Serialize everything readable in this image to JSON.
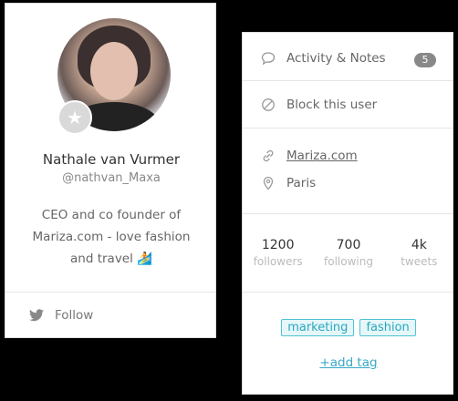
{
  "profile": {
    "name": "Nathale van Vurmer",
    "handle": "@nathvan_Maxa",
    "bio_line1": "CEO and co founder of",
    "bio_line2": "Mariza.com - love fashion",
    "bio_line3": "and travel",
    "bio_emoji": "🏄",
    "follow_label": "Follow"
  },
  "info": {
    "activity_label": "Activity & Notes",
    "activity_count": "5",
    "block_label": "Block this user",
    "website": "Mariza.com",
    "location": "Paris",
    "stats": [
      {
        "num": "1200",
        "label": "followers"
      },
      {
        "num": "700",
        "label": "following"
      },
      {
        "num": "4k",
        "label": "tweets"
      }
    ],
    "tags": [
      "marketing",
      "fashion"
    ],
    "add_tag_label": "+add tag"
  },
  "colors": {
    "tag_border": "#4ec3d6",
    "tag_text": "#2aa7bd",
    "link_accent": "#3aa8c7",
    "badge_bg": "#888888"
  },
  "icons": {
    "activity": "speech-bubble-icon",
    "block": "block-icon",
    "website": "link-icon",
    "location": "map-pin-icon",
    "follow": "twitter-bird-icon",
    "avatar_badge": "star-icon"
  }
}
